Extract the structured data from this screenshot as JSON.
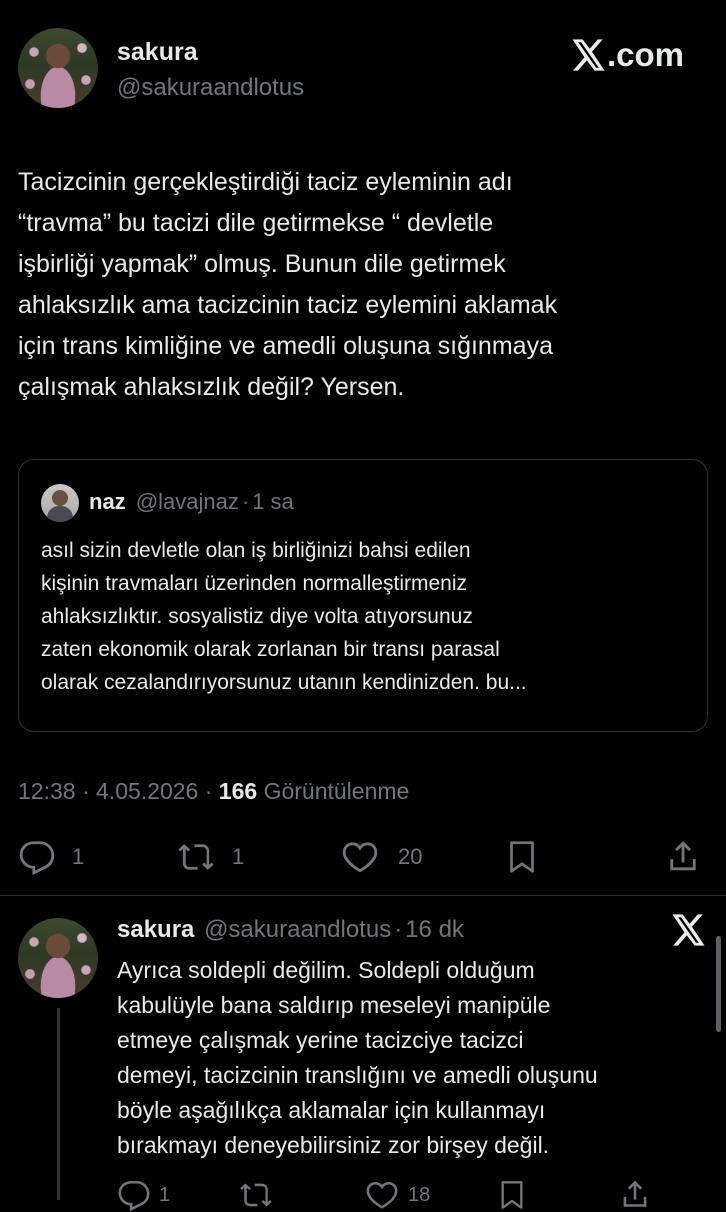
{
  "header": {
    "display_name": "sakura",
    "handle": "@sakuraandlotus",
    "brand": "X.com"
  },
  "tweet": {
    "lines": [
      "Tacizcinin gerçekleştirdiği taciz eyleminin adı",
      "“travma” bu tacizi dile getirmekse “ devletle",
      "işbirliği yapmak” olmuş.  Bunun dile getirmek",
      "ahlaksızlık ama tacizcinin taciz eylemini aklamak",
      "için trans kimliğine ve amedli oluşuna sığınmaya",
      "çalışmak ahlaksızlık değil? Yersen."
    ]
  },
  "quote": {
    "name": "naz",
    "handle": "@lavajnaz",
    "dot": "·",
    "time": "1 sa",
    "lines": [
      "asıl sizin devletle olan iş birliğinizi bahsi edilen",
      "kişinin travmaları üzerinden normalleştirmeniz",
      "ahlaksızlıktır. sosyalistiz diye volta atıyorsunuz",
      "zaten ekonomik olarak zorlanan bir transı parasal",
      "olarak cezalandırıyorsunuz utanın kendinizden. bu..."
    ]
  },
  "meta": {
    "time": "12:38",
    "sep": "·",
    "date": "4.05.2026",
    "views_count": "166",
    "views_label": "Görüntülenme"
  },
  "actions": {
    "replies": "1",
    "retweets": "1",
    "likes": "20"
  },
  "reply": {
    "name": "sakura",
    "handle": "@sakuraandlotus",
    "dot": "·",
    "time": "16 dk",
    "lines": [
      "Ayrıca soldepli değilim. Soldepli olduğum",
      "kabulüyle bana saldırıp meseleyi manipüle",
      "etmeye çalışmak yerine tacizciye tacizci",
      "demeyi, tacizcinin translığını ve amedli oluşunu",
      "böyle aşağılıkça aklamalar için kullanmayı",
      "bırakmayı deneyebilirsiniz zor birşey değil."
    ],
    "actions": {
      "replies": "1",
      "likes": "18"
    }
  },
  "icons": {
    "x_logo": "x-logo-icon",
    "reply": "reply-icon",
    "retweet": "retweet-icon",
    "like": "heart-icon",
    "bookmark": "bookmark-icon",
    "share": "share-icon"
  },
  "colors": {
    "background": "#000000",
    "text": "#e7e9ea",
    "muted": "#71767b",
    "border": "#2f3336"
  }
}
